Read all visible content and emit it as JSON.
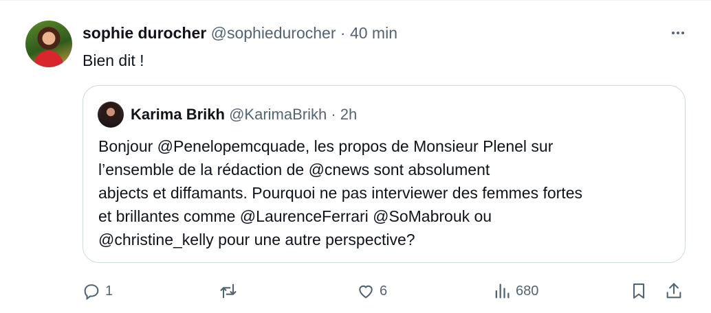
{
  "tweet": {
    "author_name": "sophie durocher",
    "handle": "@sophiedurocher",
    "separator": "·",
    "time": "40 min",
    "text": "Bien dit !",
    "avatar_icon": "avatar-photo",
    "more_icon": "more-dots-icon"
  },
  "quoted": {
    "author_name": "Karima Brikh",
    "handle": "@KarimaBrikh",
    "separator": "·",
    "time": "2h",
    "lines": [
      "Bonjour @Penelopemcquade, les propos de Monsieur Plenel sur",
      "l’ensemble de la rédaction de @cnews sont absolument",
      "abjects et diffamants. Pourquoi ne pas interviewer des femmes fortes",
      "et brillantes comme @LaurenceFerrari @SoMabrouk ou",
      "@christine_kelly pour une autre perspective?"
    ]
  },
  "actions": {
    "replies": "1",
    "retweets": "",
    "likes": "6",
    "views": "680"
  },
  "colors": {
    "text": "#0f1419",
    "muted": "#536471",
    "border": "#cfd9de"
  }
}
